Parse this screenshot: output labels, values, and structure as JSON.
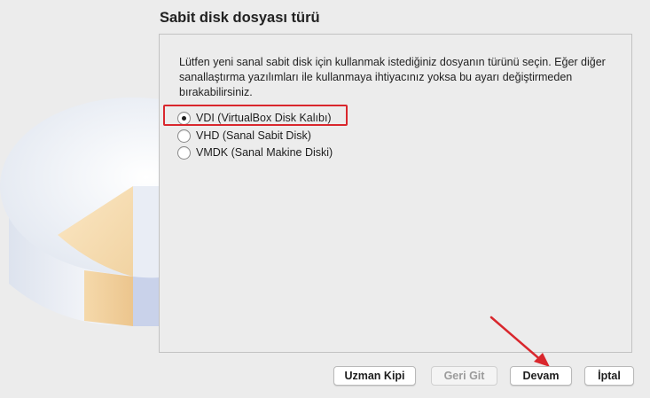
{
  "page": {
    "title": "Sabit disk dosyası türü",
    "description": "Lütfen yeni sanal sabit disk için kullanmak istediğiniz dosyanın türünü seçin. Eğer diğer sanallaştırma yazılımları ile kullanmaya ihtiyacınız yoksa bu ayarı değiştirmeden bırakabilirsiniz."
  },
  "options": [
    {
      "label": "VDI (VirtualBox Disk Kalıbı)",
      "selected": true
    },
    {
      "label": "VHD (Sanal Sabit Disk)",
      "selected": false
    },
    {
      "label": "VMDK (Sanal Makine Diski)",
      "selected": false
    }
  ],
  "buttons": {
    "expert": "Uzman Kipi",
    "back": "Geri Git",
    "continue": "Devam",
    "cancel": "İptal"
  },
  "colors": {
    "annotation": "#d9272d",
    "background": "#ececec"
  }
}
